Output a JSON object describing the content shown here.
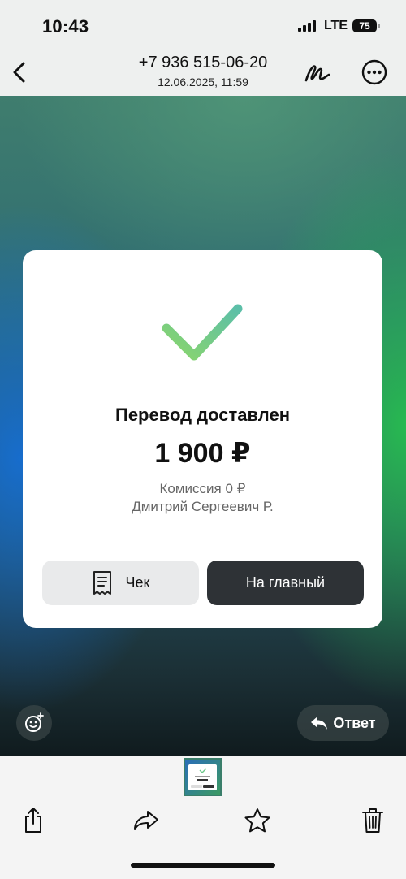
{
  "status_bar": {
    "time": "10:43",
    "network": "LTE",
    "battery": "75"
  },
  "header": {
    "phone": "+7 936 515-06-20",
    "date": "12.06.2025, 11:59",
    "icons": [
      "chevron-left-icon",
      "markup-pen-icon",
      "more-ellipsis-icon"
    ]
  },
  "receipt": {
    "status": "Перевод доставлен",
    "amount": "1 900 ₽",
    "commission": "Комиссия 0 ₽",
    "recipient": "Дмитрий Сергеевич Р.",
    "receipt_label": "Чек",
    "home_label": "На главный",
    "accent_gradient": [
      "#8bd66b",
      "#5cbfa8"
    ]
  },
  "overlay": {
    "reply_label": "Ответ"
  },
  "toolbar": {
    "icons": [
      "share-icon",
      "forward-icon",
      "star-icon",
      "trash-icon"
    ]
  },
  "colors": {
    "dark_button": "#2e3236",
    "light_button": "#e9eaeb"
  }
}
